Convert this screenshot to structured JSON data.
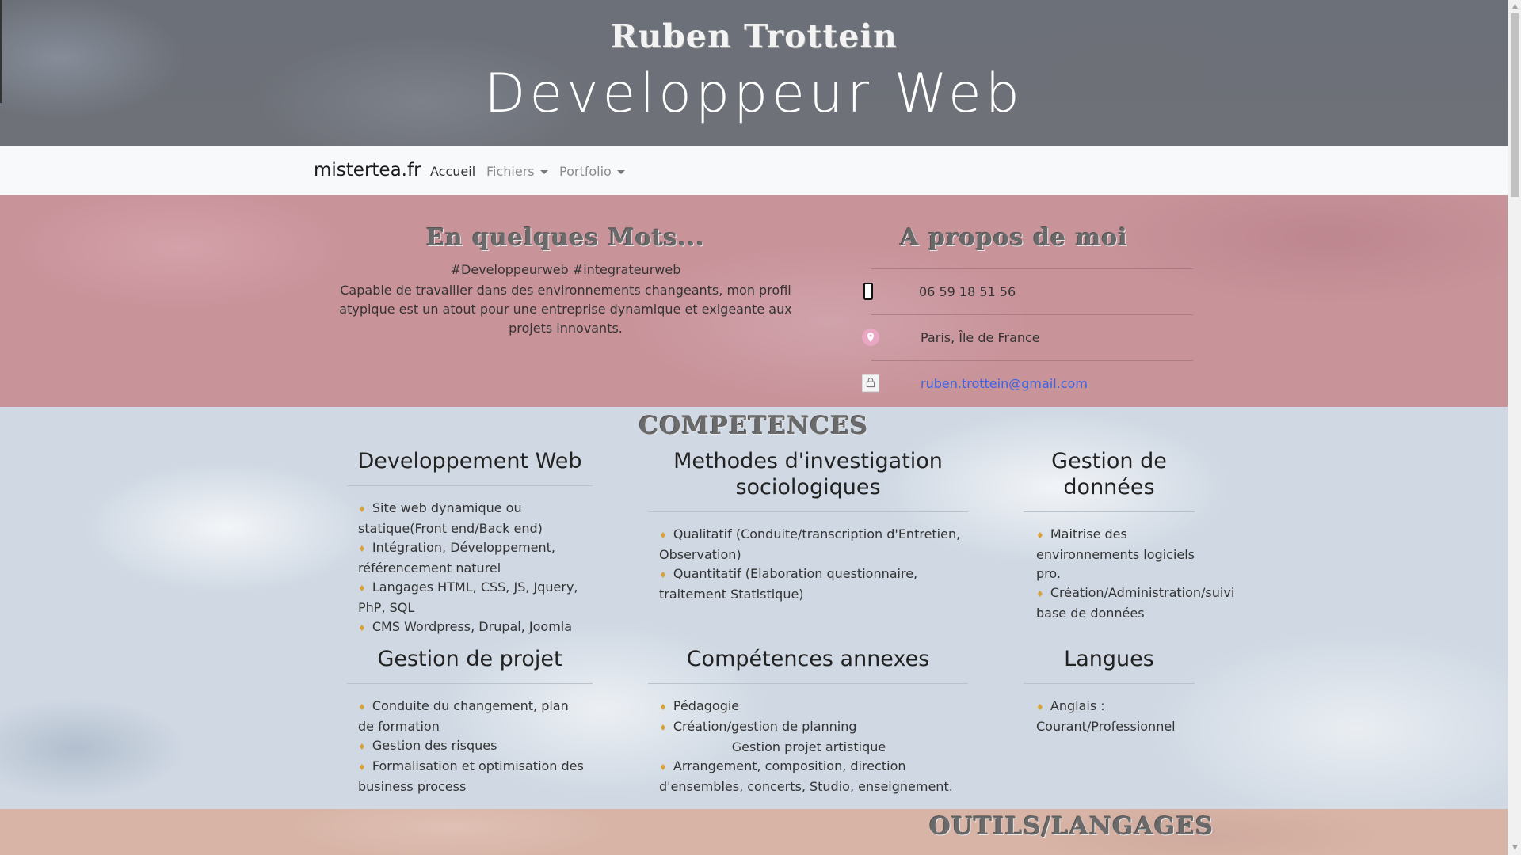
{
  "header": {
    "name": "Ruben Trottein",
    "role": "Developpeur Web"
  },
  "navbar": {
    "brand": "mistertea.fr",
    "items": [
      {
        "label": "Accueil"
      },
      {
        "label": "Fichiers"
      },
      {
        "label": "Portfolio"
      }
    ]
  },
  "about": {
    "mots_title": "En quelques Mots...",
    "tags": "#Developpeurweb #integrateurweb",
    "text": "Capable de travailler dans des environnements changeants, mon profil atypique est un atout pour une entreprise dynamique et exigeante aux projets innovants.",
    "apropos_title": "A propos de moi",
    "contacts": [
      {
        "icon": "phone-icon",
        "value": "06 59 18 51 56"
      },
      {
        "icon": "location-pin-icon",
        "value": "Paris, Île de France"
      },
      {
        "icon": "mail-icon",
        "value": "ruben.trottein@gmail.com"
      }
    ]
  },
  "competences": {
    "title": "COMPETENCES",
    "blocks": [
      {
        "title": "Developpement Web",
        "items": [
          "Site web dynamique ou statique(Front end/Back end)",
          "Intégration, Développement, référencement naturel",
          "Langages HTML, CSS, JS, Jquery, PhP, SQL",
          "CMS Wordpress, Drupal, Joomla"
        ]
      },
      {
        "title": "Methodes d'investigation sociologiques",
        "items": [
          "Qualitatif (Conduite/transcription d'Entretien, Observation)",
          "Quantitatif (Elaboration questionnaire, traitement Statistique)"
        ]
      },
      {
        "title": "Gestion de données",
        "items": [
          "Maitrise des environnements logiciels pro.",
          "Création/Administration/suivi base de données"
        ]
      },
      {
        "title": "Gestion de projet",
        "items": [
          "Conduite du changement, plan de formation",
          "Gestion des risques",
          "Formalisation et optimisation des business process"
        ]
      },
      {
        "title": "Compétences annexes",
        "items": [
          "Pédagogie",
          "Création/gestion de planning",
          "Gestion projet artistique",
          "Arrangement, composition, direction d'ensembles, concerts, Studio, enseignement."
        ]
      },
      {
        "title": "Langues",
        "items": [
          "Anglais : Courant/Professionnel"
        ]
      }
    ]
  },
  "outils": {
    "title": "OUTILS/LANGAGES"
  },
  "colors": {
    "diamond": "#d9a236",
    "link": "#3a63e6",
    "pink_section": "#c9939a"
  }
}
